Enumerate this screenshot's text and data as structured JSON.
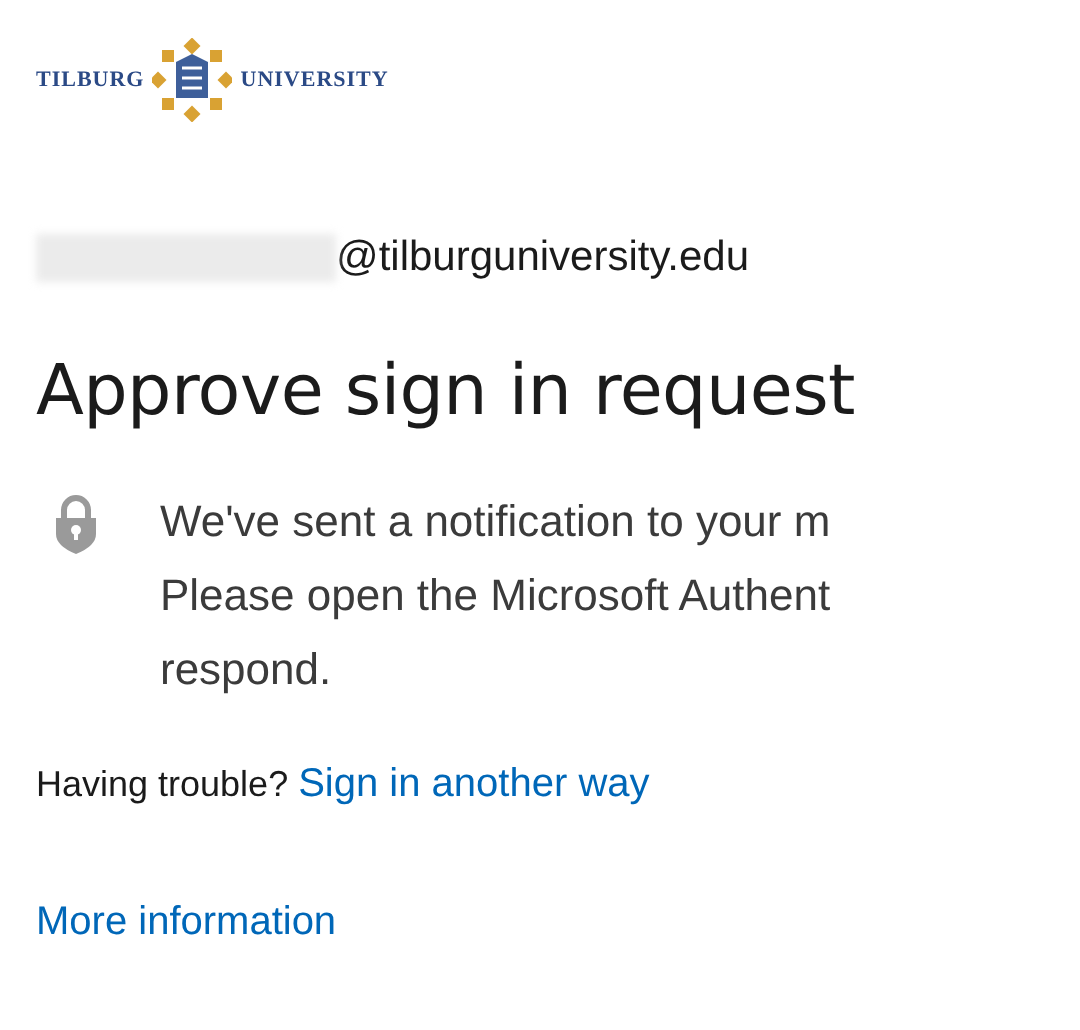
{
  "logo": {
    "left_text": "TILBURG",
    "right_text": "UNIVERSITY"
  },
  "account": {
    "email_suffix": "@tilburguniversity.edu"
  },
  "title": "Approve sign in request",
  "message_lines": [
    "We've sent a notification to your m",
    "Please open the Microsoft Authent",
    "respond."
  ],
  "trouble": {
    "text": "Having trouble?",
    "link": "Sign in another way"
  },
  "more_info_link": "More information"
}
